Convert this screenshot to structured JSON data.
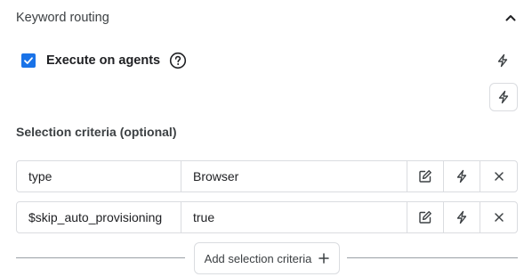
{
  "section": {
    "title": "Keyword routing",
    "collapse_icon": "chevron-up-icon"
  },
  "execute": {
    "label": "Execute on agents",
    "checked": true,
    "help_icon": "help-circle-icon"
  },
  "criteria": {
    "title": "Selection criteria (optional)",
    "rows": [
      {
        "key": "type",
        "value": "Browser"
      },
      {
        "key": "$skip_auto_provisioning",
        "value": "true"
      }
    ],
    "add_label": "Add selection criteria"
  },
  "colors": {
    "accent": "#1a73e8",
    "border": "#dadce0",
    "icon": "#5f6368",
    "text": "#202124"
  }
}
